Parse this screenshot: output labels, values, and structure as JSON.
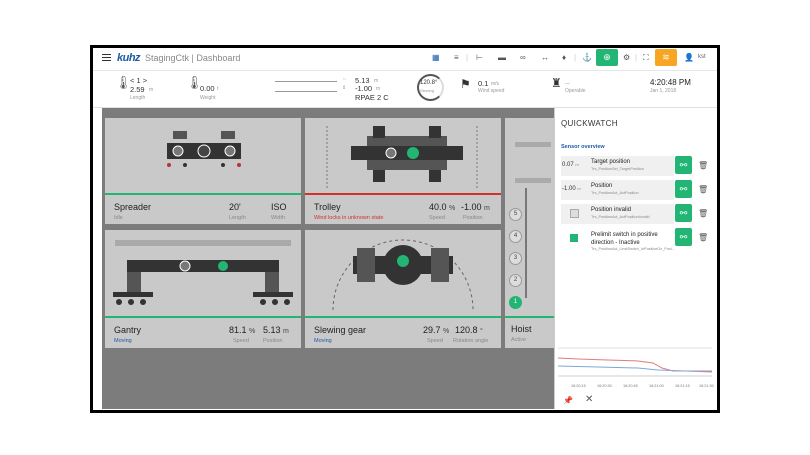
{
  "app": {
    "logo": "kuhz",
    "title": "StagingCtk | Dashboard"
  },
  "toolbar": {
    "icons": [
      "grid-icon",
      "layers-icon",
      "crane-icon",
      "ship-icon",
      "link-icon",
      "width-icon",
      "pin-icon",
      "anchor-icon",
      "gear-icon",
      "expand-icon",
      "user-icon"
    ],
    "active_green": "#22b573",
    "active_orange": "#f6a623",
    "user_label": "kst"
  },
  "status": {
    "pos_value": "2.59",
    "pos_unit": "m",
    "pos_label": "Length",
    "pos_arrows": "< 1 >",
    "weight_value": "0.00",
    "weight_unit": "t",
    "weight_label": "Weight",
    "s1": "5.13",
    "s1_unit": "m",
    "s2": "-1.00",
    "s2_unit": "m",
    "rpae": "RPAE 2 C",
    "slew_value": "120.8°",
    "slew_label": "Slewing",
    "wind_value": "0.1",
    "wind_unit": "m/s",
    "wind_label": "Wind speed",
    "op_dash": "—",
    "op_label": "Operable",
    "time": "4:20:48 PM",
    "date": "Jan 1, 2018"
  },
  "cards": [
    {
      "name": "Spreader",
      "sub": "Idle",
      "sub_color": "#888888",
      "v1": "20'",
      "l1": "Length",
      "v2": "ISO",
      "l2": "Width",
      "bar": "#22b573"
    },
    {
      "name": "Trolley",
      "sub": "Wind locks in unknown state",
      "sub_color": "#d0312d",
      "v1": "40.0",
      "u1": "%",
      "l1": "Speed",
      "v2": "-1.00",
      "u2": "m",
      "l2": "Position",
      "bar": "#d0312d"
    },
    {
      "name": "Gantry",
      "sub": "Moving",
      "sub_color": "#1c5aa6",
      "v1": "81.1",
      "u1": "%",
      "l1": "Speed",
      "v2": "5.13",
      "u2": "m",
      "l2": "Position",
      "bar": "#22b573"
    },
    {
      "name": "Slewing gear",
      "sub": "Moving",
      "sub_color": "#1c5aa6",
      "v1": "29.7",
      "u1": "%",
      "l1": "Speed",
      "v2": "120.8",
      "u2": "°",
      "l2": "Rotation angle",
      "bar": "#22b573"
    },
    {
      "name": "Hoist",
      "sub": "Active",
      "sub_color": "#888888",
      "bar": "#22b573"
    }
  ],
  "hoist_levels": [
    "5",
    "4",
    "3",
    "2",
    "1"
  ],
  "quickwatch": {
    "title": "QUICKWATCH",
    "section": "Sensor overview",
    "rows": [
      {
        "num": "0.07",
        "unit": "m",
        "name": "Target position",
        "sub": "Trs_PositionSet_TargetPosition"
      },
      {
        "num": "-1.00",
        "unit": "m",
        "name": "Position",
        "sub": "Trs_PositionAct_ActPosition"
      },
      {
        "num": "",
        "unit": "",
        "name": "Position invalid",
        "sub": "Trs_PositionAct_ActPositionInvalid"
      },
      {
        "num": "",
        "unit": "",
        "name": "Prelimit switch in positive direction - Inactive",
        "sub": "Trs_PositionAct_LimitSwitch_InPositiveDir_Posi..."
      }
    ],
    "chart_labels": [
      "16:20:15",
      "16:20:30",
      "16:20:45",
      "16:21:00",
      "16:21:15",
      "16:21:30"
    ],
    "footer_icons": [
      "pin-icon",
      "close-icon"
    ]
  }
}
